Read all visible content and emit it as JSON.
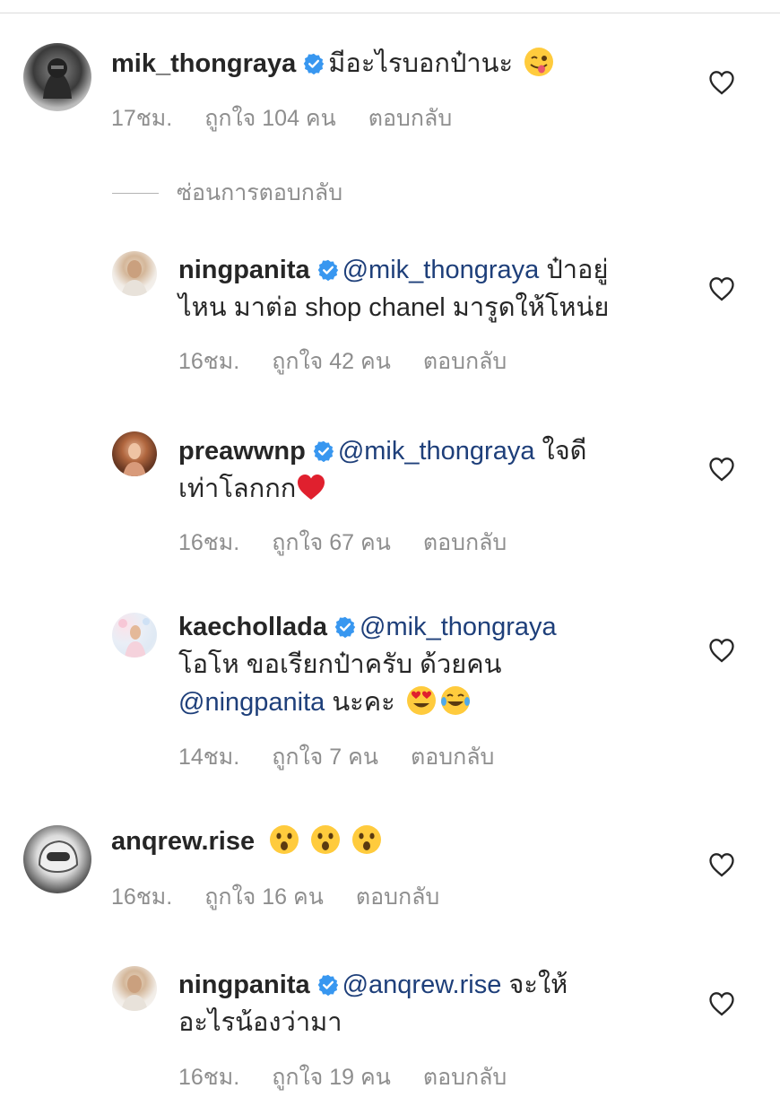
{
  "hide_replies_label": "ซ่อนการตอบกลับ",
  "colors": {
    "mention": "#1e3f7a",
    "verified": "#3897f0",
    "meta": "#8e8e8e"
  },
  "comments": [
    {
      "username": "mik_thongraya",
      "text": "มีอะไรบอกป๋านะ",
      "time": "17ชม.",
      "likes": "ถูกใจ 104 คน",
      "reply": "ตอบกลับ",
      "emojis": [
        "winking-tongue-emoji"
      ]
    },
    {
      "username": "ningpanita",
      "mention": "@mik_thongraya",
      "text": "ป๋าอยู่",
      "text2": "ไหน มาต่อ shop chanel มารูดให้โหน่ย",
      "time": "16ชม.",
      "likes": "ถูกใจ 42 คน",
      "reply": "ตอบกลับ"
    },
    {
      "username": "preawwnp",
      "mention": "@mik_thongraya",
      "text": "ใจดี",
      "text2": "เท่าโลกกก",
      "time": "16ชม.",
      "likes": "ถูกใจ 67 คน",
      "reply": "ตอบกลับ",
      "emojis": [
        "red-heart-emoji"
      ]
    },
    {
      "username": "kaechollada",
      "mention": "@mik_thongraya",
      "text2": "โอโห ขอเรียกป๋าครับ ด้วยคน",
      "mention2": "@ningpanita",
      "text3": "นะคะ",
      "time": "14ชม.",
      "likes": "ถูกใจ 7 คน",
      "reply": "ตอบกลับ",
      "emojis": [
        "heart-eyes-emoji",
        "tears-of-joy-emoji"
      ]
    },
    {
      "username": "anqrew.rise",
      "time": "16ชม.",
      "likes": "ถูกใจ 16 คน",
      "reply": "ตอบกลับ",
      "emojis": [
        "astonished-emoji",
        "astonished-emoji",
        "astonished-emoji"
      ]
    },
    {
      "username": "ningpanita",
      "mention": "@anqrew.rise",
      "text": "จะให้",
      "text2": "อะไรน้องว่ามา",
      "time": "16ชม.",
      "likes": "ถูกใจ 19 คน",
      "reply": "ตอบกลับ"
    }
  ]
}
